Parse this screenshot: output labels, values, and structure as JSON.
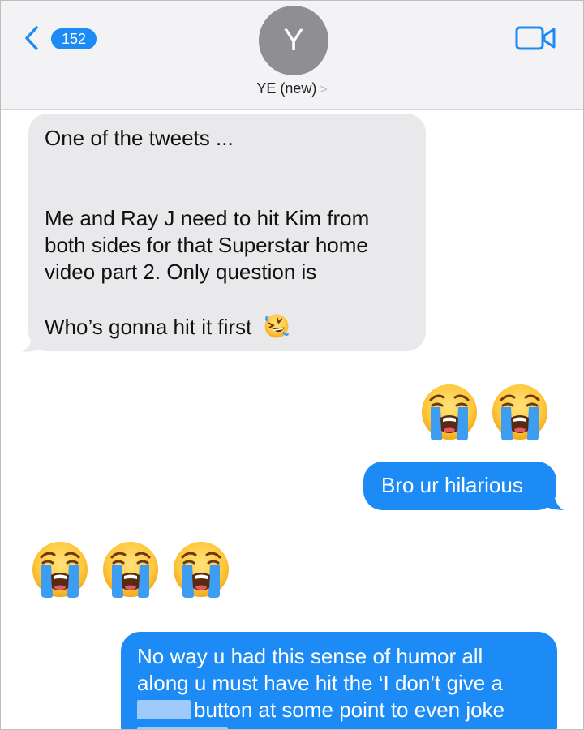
{
  "header": {
    "back_count": "152",
    "avatar_initial": "Y",
    "contact_name": "YE (new)",
    "contact_chevron": ">"
  },
  "messages": {
    "m1_line1": "One of the tweets ...",
    "m1_line2": "Me and Ray J need to hit Kim from",
    "m1_line3": "both sides for that Superstar home",
    "m1_line4": "video part 2. Only question is",
    "m1_line5": "Who’s gonna hit it first",
    "m2": "Bro ur hilarious",
    "m3_line1": "No way u had this sense of humor all",
    "m3_line2": "along u must have hit the ‘I don’t give a",
    "m3_line3": "button at some point to even joke"
  },
  "emoji": {
    "row1": [
      "loudly-crying-face",
      "loudly-crying-face"
    ],
    "row2": [
      "loudly-crying-face",
      "loudly-crying-face",
      "loudly-crying-face"
    ],
    "inline": "rolling-on-floor-laughing"
  },
  "colors": {
    "accent": "#1d8bf5",
    "incoming_bubble": "#e9e9eb",
    "header_bg": "#f3f3f6",
    "avatar_bg": "#8e8e93"
  }
}
